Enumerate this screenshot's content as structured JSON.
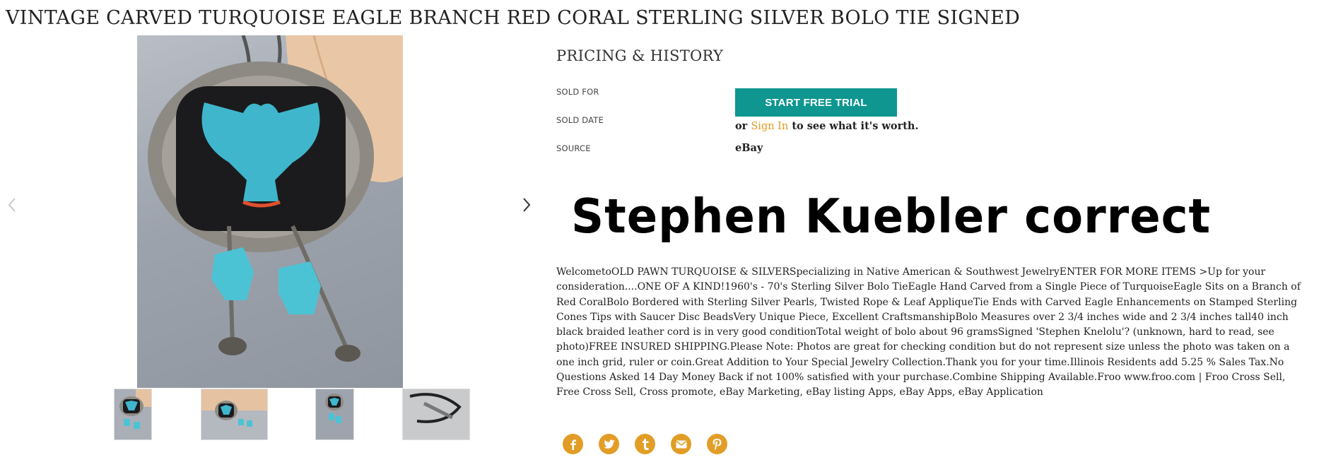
{
  "product": {
    "title": "VINTAGE CARVED TURQUOISE EAGLE BRANCH RED CORAL STERLING SILVER BOLO TIE SIGNED"
  },
  "gallery": {
    "thumbnails_count": 4,
    "prev_icon": "chevron-left-icon",
    "next_icon": "chevron-right-icon"
  },
  "pricing": {
    "heading": "PRICING & HISTORY",
    "sold_for_label": "SOLD FOR",
    "sold_date_label": "SOLD DATE",
    "source_label": "SOURCE",
    "trial_button": "START FREE TRIAL",
    "or_text": "or",
    "sign_in_link": "Sign In",
    "after_sign_in": "to see what it's worth.",
    "source_value": "eBay"
  },
  "note": {
    "handwritten": "Stephen Kuebler correct"
  },
  "description": "WelcometoOLD PAWN TURQUOISE & SILVERSpecializing in Native American & Southwest JewelryENTER FOR MORE ITEMS >Up for your consideration....ONE OF A KIND!1960's - 70's Sterling Silver Bolo TieEagle Hand Carved from a Single Piece of TurquoiseEagle Sits on a Branch of Red CoralBolo Bordered with Sterling Silver Pearls, Twisted Rope & Leaf AppliqueTie Ends with Carved Eagle Enhancements on Stamped Sterling Cones Tips with Saucer Disc BeadsVery Unique Piece, Excellent CraftsmanshipBolo Measures over 2 3/4 inches wide and 2 3/4 inches tall40 inch black braided leather cord is in very good conditionTotal weight of bolo about 96 gramsSigned 'Stephen Knelolu'? (unknown, hard to read, see photo)FREE INSURED SHIPPING.Please Note: Photos are great for checking condition but do not represent size unless the photo was taken on a one inch grid, ruler or coin.Great Addition to Your Special Jewelry Collection.Thank you for your time.Illinois Residents add 5.25 % Sales Tax.No Questions Asked 14 Day Money Back if not 100% satisfied with your purchase.Combine Shipping Available.Froo www.froo.com | Froo Cross Sell, Free Cross Sell, Cross promote, eBay Marketing, eBay listing Apps, eBay Apps, eBay Application",
  "share": [
    {
      "icon": "facebook-icon"
    },
    {
      "icon": "twitter-icon"
    },
    {
      "icon": "tumblr-icon"
    },
    {
      "icon": "email-icon"
    },
    {
      "icon": "pinterest-icon"
    }
  ],
  "colors": {
    "accent": "#0f9690",
    "link": "#e39a22",
    "share": "#e29d26",
    "turquoise": "#3fb6cc"
  }
}
